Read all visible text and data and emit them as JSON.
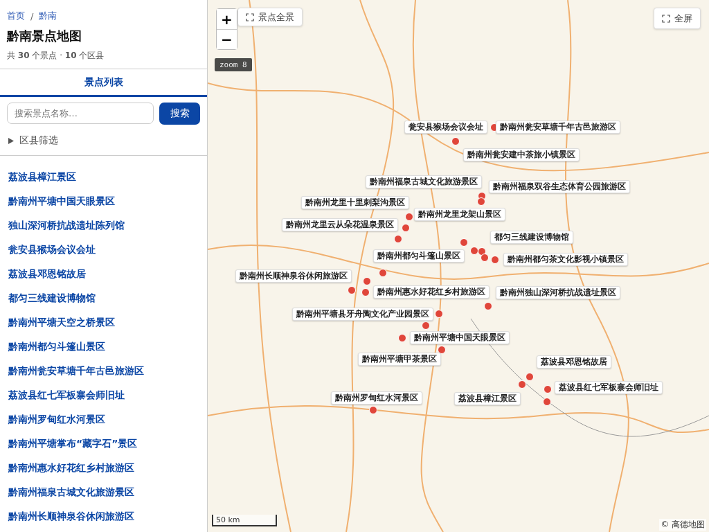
{
  "breadcrumb": [
    {
      "label": "首页"
    },
    {
      "label": "黔南"
    }
  ],
  "breadcrumb_separator": "/",
  "title": "黔南景点地图",
  "stats": "共 **30** 个景点 · **10** 个区县",
  "tabs": [
    {
      "label": "景点列表",
      "selected": true
    }
  ],
  "search": {
    "placeholder": "搜索景点名称…",
    "button": "搜索"
  },
  "filter": {
    "label": "区县筛选",
    "expanded": false
  },
  "spots": [
    {
      "name": "荔波县樟江景区"
    },
    {
      "name": "黔南州平塘中国天眼景区"
    },
    {
      "name": "独山深河桥抗战遗址陈列馆"
    },
    {
      "name": "瓮安县猴场会议会址"
    },
    {
      "name": "荔波县邓恩铭故居"
    },
    {
      "name": "都匀三线建设博物馆"
    },
    {
      "name": "黔南州平塘天空之桥景区"
    },
    {
      "name": "黔南州都匀斗篷山景区"
    },
    {
      "name": "黔南州瓮安草塘千年古邑旅游区"
    },
    {
      "name": "荔波县红七军板寨会师旧址"
    },
    {
      "name": "黔南州罗甸红水河景区"
    },
    {
      "name": "黔南州平塘掌布“藏字石”景区"
    },
    {
      "name": "黔南州惠水好花红乡村旅游区"
    },
    {
      "name": "黔南州福泉古城文化旅游景区"
    },
    {
      "name": "黔南州长顺神泉谷休闲旅游区"
    }
  ],
  "map": {
    "zoom_in": "+",
    "zoom_out": "−",
    "overview_button": "景点全景",
    "fullscreen_button": "全屏",
    "zoom_badge": "zoom 8",
    "scale": "50 km",
    "attribution": "© 高德地图",
    "labels": [
      {
        "text": "瓮安县猴场会议会址"
      },
      {
        "text": "黔南州瓮安草塘千年古邑旅游区"
      },
      {
        "text": "黔南州瓮安建中茶旅小镇景区"
      },
      {
        "text": "黔南州福泉古城文化旅游景区"
      },
      {
        "text": "黔南州福泉双谷生态体育公园旅游区"
      },
      {
        "text": "黔南州龙里十里刺梨沟景区"
      },
      {
        "text": "黔南州龙里龙架山景区"
      },
      {
        "text": "黔南州龙里云从朵花温泉景区"
      },
      {
        "text": "都匀三线建设博物馆"
      },
      {
        "text": "黔南州都匀斗篷山景区"
      },
      {
        "text": "黔南州都匀茶文化影视小镇景区"
      },
      {
        "text": "黔南州长顺神泉谷休闲旅游区"
      },
      {
        "text": "黔南州惠水好花红乡村旅游区"
      },
      {
        "text": "黔南州独山深河桥抗战遗址景区"
      },
      {
        "text": "黔南州平塘县牙舟陶文化产业园景区"
      },
      {
        "text": "黔南州平塘中国天眼景区"
      },
      {
        "text": "黔南州平塘甲茶景区"
      },
      {
        "text": "荔波县邓恩铭故居"
      },
      {
        "text": "荔波县红七军板寨会师旧址"
      },
      {
        "text": "黔南州罗甸红水河景区"
      },
      {
        "text": "荔波县樟江景区"
      }
    ]
  }
}
